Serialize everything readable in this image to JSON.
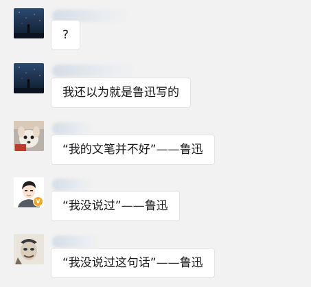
{
  "messages": [
    {
      "avatar": "night-sky-avatar",
      "text": "?"
    },
    {
      "avatar": "night-sky-avatar",
      "text": "我还以为就是鲁迅写的"
    },
    {
      "avatar": "chihuahua-avatar",
      "text": "“我的文笔并不好”——鲁迅"
    },
    {
      "avatar": "cartoon-man-verified-avatar",
      "text": "“我没说过”——鲁迅"
    },
    {
      "avatar": "meme-face-avatar",
      "text": "“我没说过这句话”——鲁迅"
    }
  ],
  "colors": {
    "background": "#f2f2f2",
    "bubble": "#ffffff",
    "verified_badge": "#f5a623"
  }
}
